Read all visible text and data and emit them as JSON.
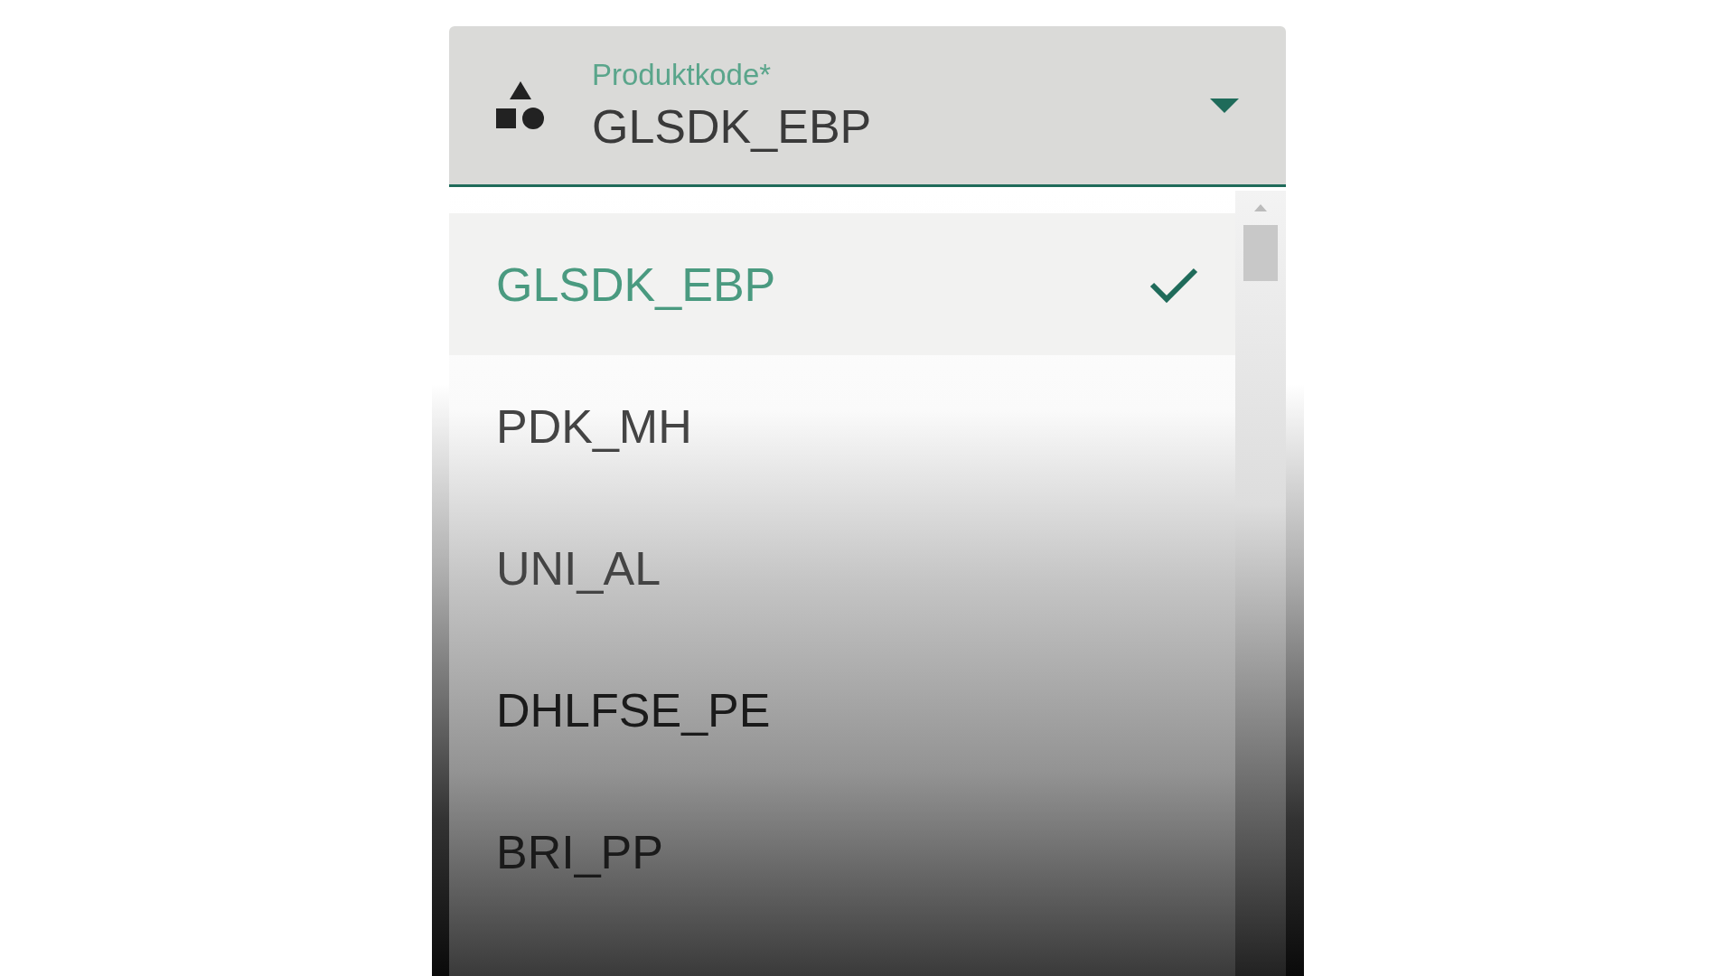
{
  "field": {
    "label": "Produktkode*",
    "value": "GLSDK_EBP"
  },
  "options": [
    {
      "label": "GLSDK_EBP",
      "selected": true
    },
    {
      "label": "PDK_MH",
      "selected": false
    },
    {
      "label": "UNI_AL",
      "selected": false
    },
    {
      "label": "DHLFSE_PE",
      "selected": false
    },
    {
      "label": "BRI_PP",
      "selected": false
    }
  ]
}
